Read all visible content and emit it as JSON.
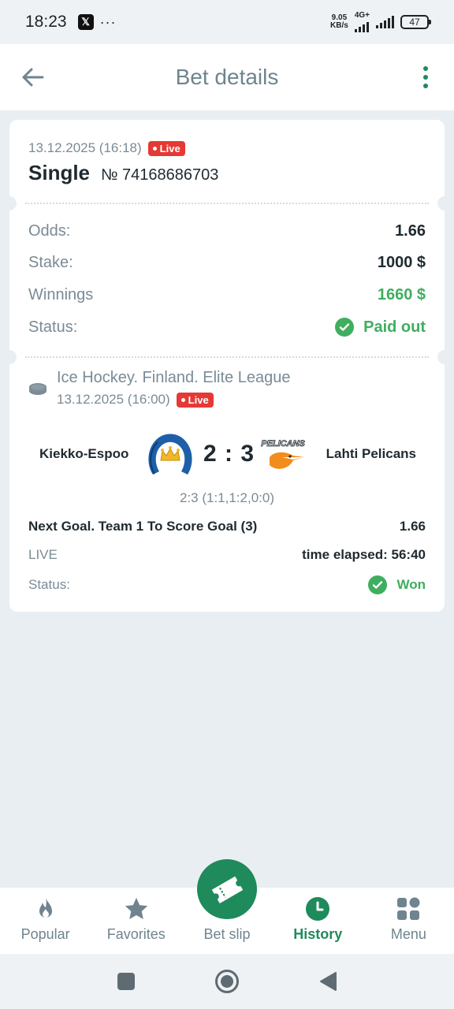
{
  "status_bar": {
    "time": "18:23",
    "x_badge": "𝕏",
    "dots": "···",
    "net_speed_value": "9.05",
    "net_speed_unit": "KB/s",
    "network_type": "4G+",
    "battery": "47"
  },
  "header": {
    "title": "Bet details"
  },
  "bet": {
    "timestamp": "13.12.2025 (16:18)",
    "live_label": "Live",
    "type": "Single",
    "number": "№ 74168686703",
    "odds_label": "Odds:",
    "odds_value": "1.66",
    "stake_label": "Stake:",
    "stake_value": "1000 $",
    "winnings_label": "Winnings",
    "winnings_value": "1660 $",
    "status_label": "Status:",
    "status_value": "Paid out",
    "status_color": "#3fae5f"
  },
  "event": {
    "league": "Ice Hockey. Finland. Elite League",
    "date": "13.12.2025 (16:00)",
    "live_label": "Live",
    "team1": "Kiekko-Espoo",
    "team2": "Lahti Pelicans",
    "score": "2 : 3",
    "score_detail": "2:3 (1:1,1:2,0:0)",
    "market": "Next Goal. Team 1 To Score Goal (3)",
    "market_odds": "1.66",
    "live_text": "LIVE",
    "time_elapsed": "time elapsed: 56:40",
    "status_label": "Status:",
    "status_value": "Won",
    "team2_logo_text": "PELICANS"
  },
  "bottom_nav": {
    "items": [
      {
        "label": "Popular",
        "icon": "flame-icon"
      },
      {
        "label": "Favorites",
        "icon": "star-icon"
      },
      {
        "label": "Bet slip",
        "icon": "ticket-icon"
      },
      {
        "label": "History",
        "icon": "clock-icon",
        "active": true
      },
      {
        "label": "Menu",
        "icon": "grid-icon"
      }
    ]
  },
  "colors": {
    "accent": "#1f8a5b",
    "live": "#e53935",
    "win": "#3fae5f"
  }
}
